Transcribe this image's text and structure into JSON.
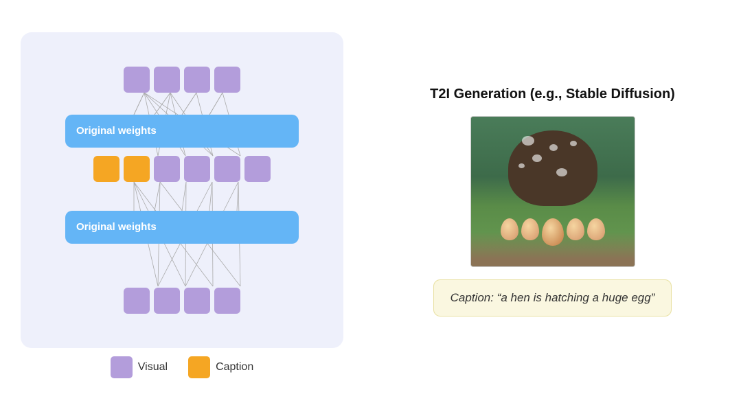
{
  "left": {
    "weight_label_top": "Original weights",
    "weight_label_bottom": "Original weights",
    "legend": {
      "visual_label": "Visual",
      "caption_label": "Caption",
      "visual_color": "#b39ddb",
      "caption_color": "#f5a623"
    }
  },
  "right": {
    "title": "T2I Generation (e.g., Stable Diffusion)",
    "caption_text": "Caption: “a hen is hatching a huge egg”"
  }
}
